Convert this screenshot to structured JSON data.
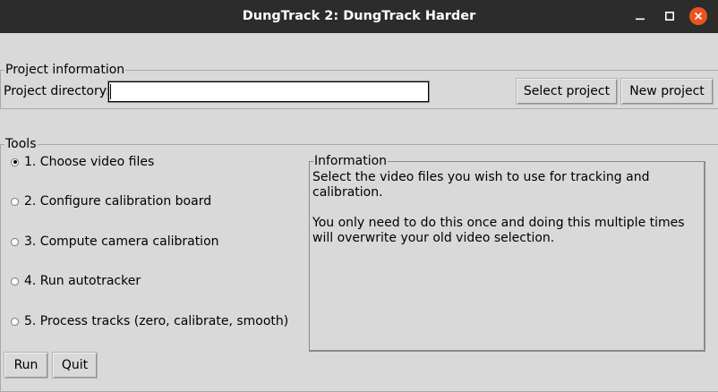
{
  "window": {
    "title": "DungTrack 2: DungTrack Harder"
  },
  "project": {
    "legend": "Project information",
    "directory_label": "Project directory:",
    "directory_value": "",
    "select_button": "Select project",
    "new_button": "New project"
  },
  "tools": {
    "legend": "Tools",
    "selected_index": 0,
    "options": [
      "1. Choose video files",
      "2. Configure calibration board",
      "3. Compute camera calibration",
      "4. Run autotracker",
      "5. Process tracks (zero, calibrate, smooth)"
    ]
  },
  "information": {
    "legend": "Information",
    "paragraphs": [
      "Select the video files you wish to use for tracking and calibration.",
      "You only need to do this once and doing this multiple times will overwrite your old video selection."
    ]
  },
  "actions": {
    "run_button": "Run",
    "quit_button": "Quit"
  },
  "colors": {
    "titlebar": "#2c2c2c",
    "close_button": "#e95420",
    "background": "#d9d9d9"
  }
}
